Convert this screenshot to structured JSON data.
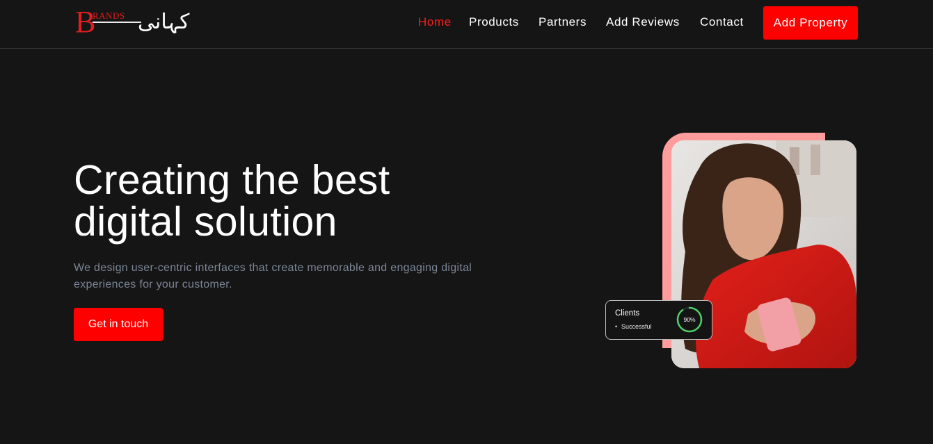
{
  "brand": {
    "logo_initial": "B",
    "logo_word": "RANDS",
    "logo_urdu": "کہانی"
  },
  "nav": {
    "items": [
      {
        "label": "Home",
        "active": true
      },
      {
        "label": "Products",
        "active": false
      },
      {
        "label": "Partners",
        "active": false
      },
      {
        "label": "Add Reviews",
        "active": false
      },
      {
        "label": "Contact",
        "active": false
      }
    ],
    "cta_label": "Add Property"
  },
  "hero": {
    "title_line1": "Creating the best",
    "title_line2": "digital solution",
    "subtitle_line1": "We design user-centric interfaces that create memorable and engaging digital",
    "subtitle_line2": "experiences for your customer.",
    "cta_label": "Get in touch"
  },
  "clients_card": {
    "title": "Clients",
    "bullet": "•",
    "status": "Successful",
    "percent_label": "90%",
    "percent_value": 0.9
  },
  "colors": {
    "accent": "#ff0000",
    "background": "#151515",
    "subtitle": "#7b8596",
    "frame_pink": "#ff9c9c",
    "ring_green": "#4fd06a"
  }
}
